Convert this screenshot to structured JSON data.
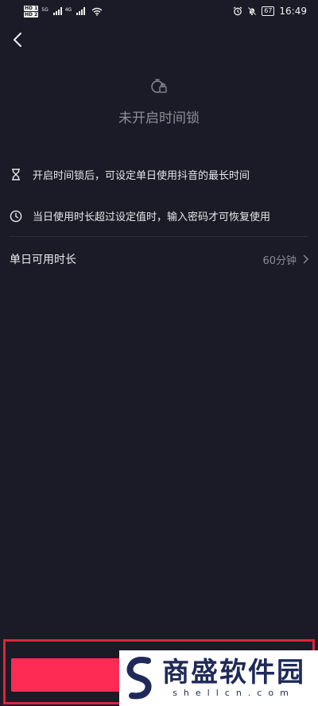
{
  "status_bar": {
    "sim1": "HD 1",
    "sim2": "HD 2",
    "net1": "5G",
    "net2": "4G",
    "battery": "67",
    "time": "16:49"
  },
  "header": {
    "title": "未开启时间锁"
  },
  "info": [
    {
      "icon": "hourglass-icon",
      "text": "开启时间锁后，可设定单日使用抖音的最长时间"
    },
    {
      "icon": "clock-icon",
      "text": "当日使用时长超过设定值时，输入密码才可恢复使用"
    }
  ],
  "setting": {
    "label": "单日可用时长",
    "value": "60分钟"
  },
  "watermark": {
    "cn": "商盛软件园",
    "en": "shellcn.com"
  },
  "colors": {
    "background": "#1b1b27",
    "primary_button": "#fe2c55",
    "highlight": "#d9263a"
  }
}
